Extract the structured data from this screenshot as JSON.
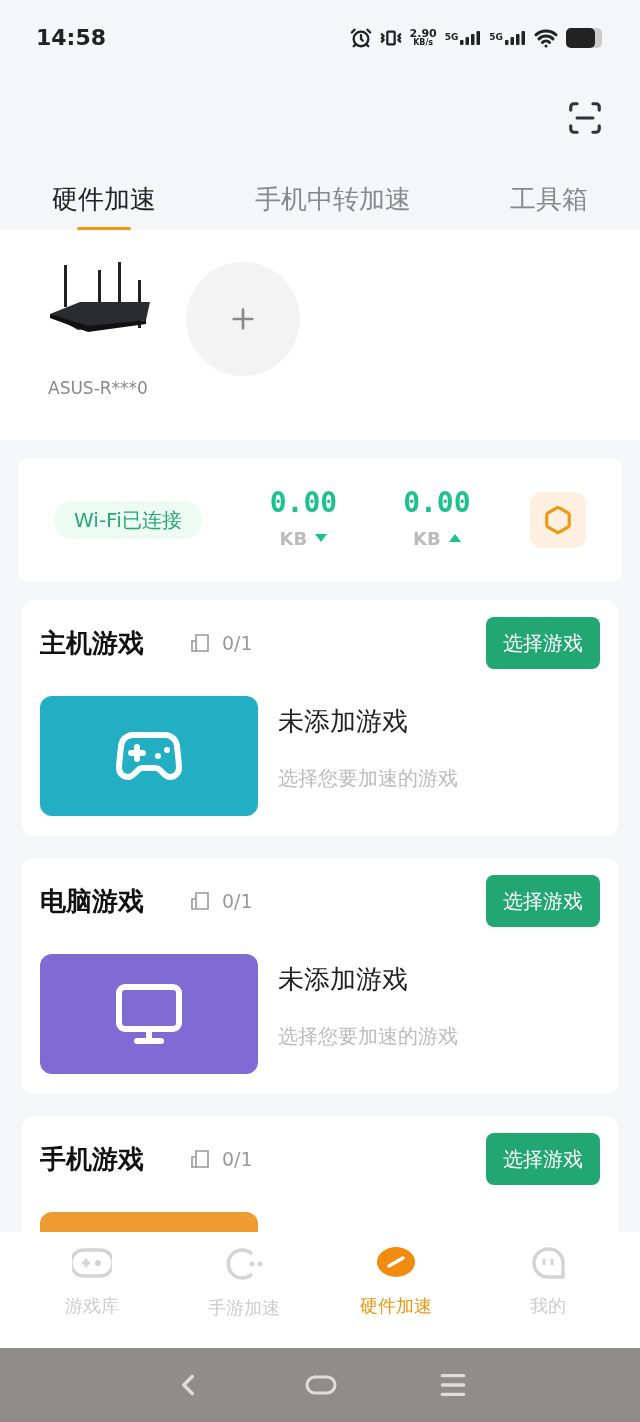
{
  "status_bar": {
    "time": "14:58",
    "speed": "2.90",
    "speed_unit": "KB/s",
    "networks": [
      "5G",
      "5G"
    ]
  },
  "tabs": [
    {
      "label": "硬件加速",
      "selected": true
    },
    {
      "label": "手机中转加速",
      "selected": false
    },
    {
      "label": "工具箱",
      "selected": false
    }
  ],
  "devices": [
    {
      "name": "ASUS-R***0",
      "kind": "picture"
    }
  ],
  "stats": {
    "wifi": "Wi-Fi已连接",
    "download": {
      "value": "0.00",
      "unit": "KB"
    },
    "upload": {
      "value": "0.00",
      "unit": "KB"
    }
  },
  "game_cards": [
    {
      "kind": "console",
      "title": "主机游戏",
      "count": "0/1",
      "button": "选择游戏",
      "color": "#22afc4",
      "empty_title": "未添加游戏",
      "hint": "选择您要加速的游戏"
    },
    {
      "kind": "pc",
      "title": "电脑游戏",
      "count": "0/1",
      "button": "选择游戏",
      "color": "#7f6bd3",
      "empty_title": "未添加游戏",
      "hint": "选择您要加速的游戏"
    },
    {
      "kind": "mobile",
      "title": "手机游戏",
      "count": "0/1",
      "button": "选择游戏",
      "color": "#ee9c30"
    }
  ],
  "bottom_nav": [
    {
      "label": "游戏库",
      "kind": "library",
      "selected": false
    },
    {
      "label": "手游加速",
      "kind": "mobile",
      "selected": false
    },
    {
      "label": "硬件加速",
      "kind": "hardware",
      "selected": true
    },
    {
      "label": "我的",
      "kind": "me",
      "selected": false
    }
  ]
}
